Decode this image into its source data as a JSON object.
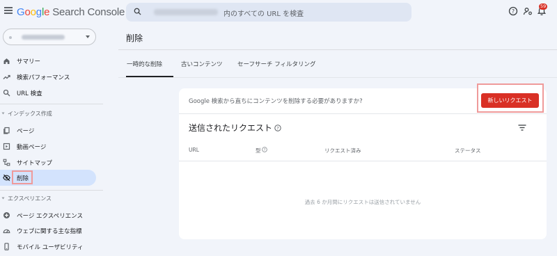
{
  "header": {
    "logo_google": [
      "G",
      "o",
      "o",
      "g",
      "l",
      "e"
    ],
    "logo_product": "Search Console",
    "search_placeholder": "内のすべての URL を検査",
    "notification_count": "59"
  },
  "sidebar": {
    "items_top": [
      {
        "label": "サマリー",
        "icon": "home-icon"
      },
      {
        "label": "検索パフォーマンス",
        "icon": "trending-icon"
      },
      {
        "label": "URL 検査",
        "icon": "search-icon"
      }
    ],
    "section_index": "インデックス作成",
    "items_index": [
      {
        "label": "ページ",
        "icon": "pages-icon"
      },
      {
        "label": "動画ページ",
        "icon": "video-icon"
      },
      {
        "label": "サイトマップ",
        "icon": "sitemap-icon"
      },
      {
        "label": "削除",
        "icon": "removal-icon"
      }
    ],
    "section_experience": "エクスペリエンス",
    "items_experience": [
      {
        "label": "ページ エクスペリエンス",
        "icon": "plus-circle-icon"
      },
      {
        "label": "ウェブに関する主な指標",
        "icon": "speed-icon"
      },
      {
        "label": "モバイル ユーザビリティ",
        "icon": "phone-icon"
      }
    ]
  },
  "main": {
    "title": "削除",
    "tabs": [
      "一時的な削除",
      "古いコンテンツ",
      "セーフサーチ フィルタリング"
    ],
    "question": "Google 検索から直ちにコンテンツを削除する必要がありますか?",
    "new_request_label": "新しいリクエスト",
    "submitted_title": "送信されたリクエスト",
    "columns": [
      "URL",
      "型",
      "リクエスト済み",
      "ステータス"
    ],
    "empty_message": "過去 6 か月間にリクエストは送信されていません"
  },
  "colors": {
    "accent_red": "#d93025",
    "highlight_pink": "#ef9a9a",
    "active_nav": "#d3e3fd"
  }
}
